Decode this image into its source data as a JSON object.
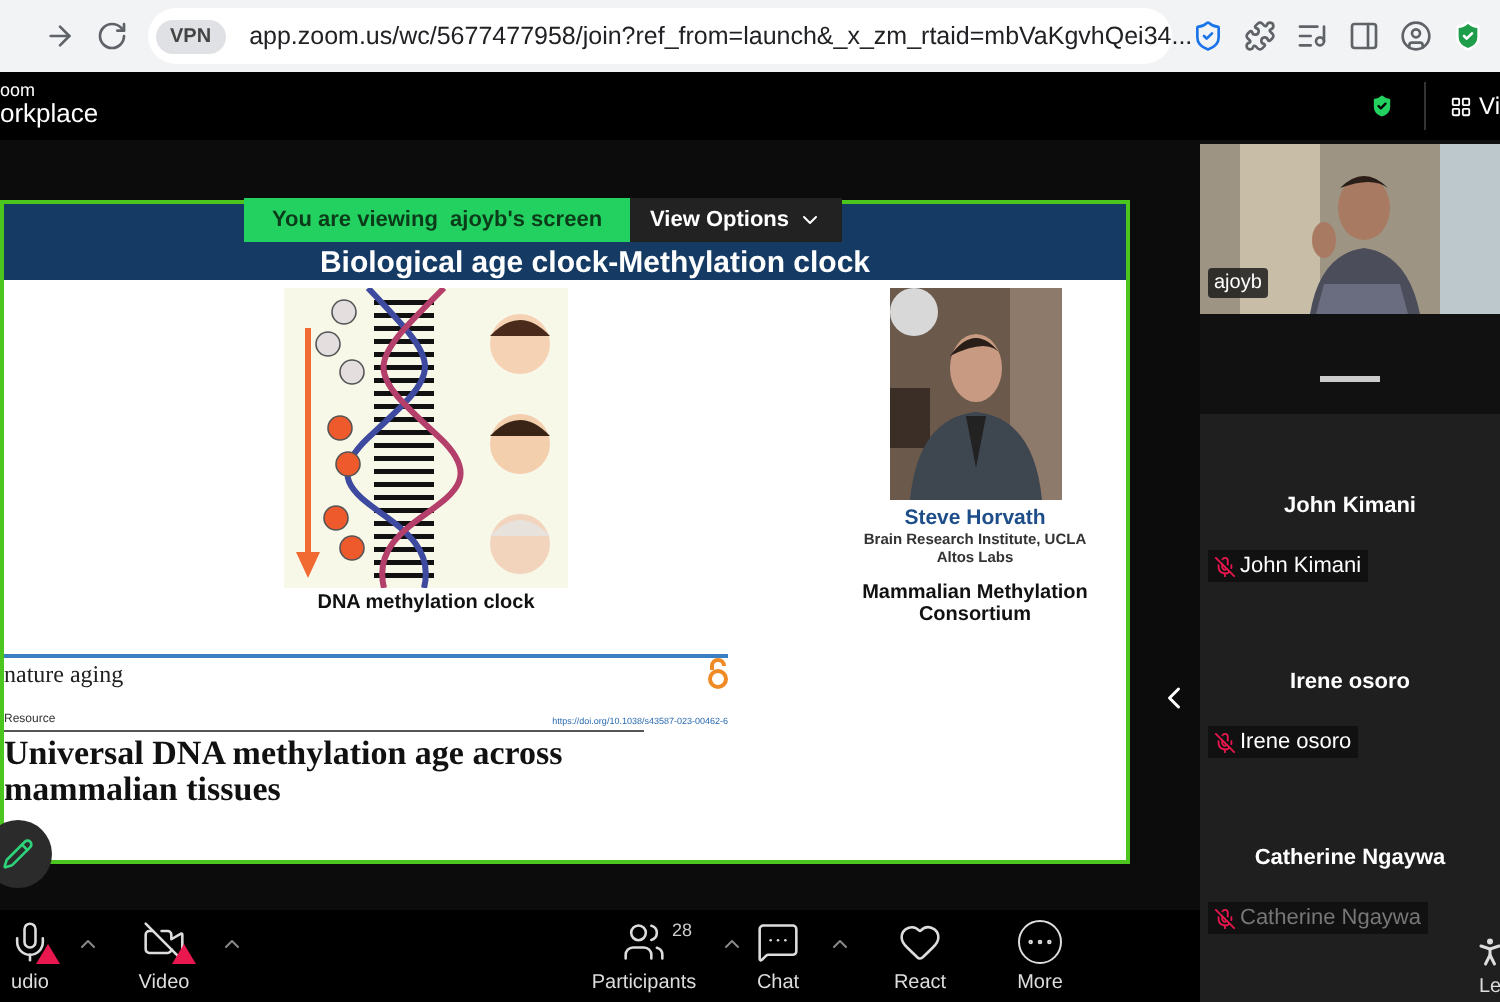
{
  "browser": {
    "vpn_badge": "VPN",
    "url": "app.zoom.us/wc/5677477958/join?ref_from=launch&_x_zm_rtaid=mbVaKgvhQei34..."
  },
  "app_bar": {
    "brand": [
      "oom",
      "orkplace"
    ],
    "view_button": "Vi"
  },
  "share_banner": {
    "viewing": "You are viewing  ajoyb's screen",
    "options": "View Options"
  },
  "slide": {
    "title": "Biological age clock-Methylation clock",
    "figure_caption": "DNA methylation clock",
    "speaker": {
      "name": "Steve Horvath",
      "affiliation": [
        "Brain Research Institute, UCLA",
        "Altos Labs"
      ]
    },
    "consortium": "Mammalian Methylation Consortium",
    "paper": {
      "journal": "nature aging",
      "section": "Resource",
      "doi": "https://doi.org/10.1038/s43587-023-00462-6",
      "title": "Universal DNA methylation age across mammalian tissues"
    }
  },
  "self_video": {
    "name": "ajoyb"
  },
  "participants": [
    {
      "name": "John Kimani",
      "label": "John Kimani",
      "muted": true
    },
    {
      "name": "Irene osoro",
      "label": "Irene osoro",
      "muted": true
    },
    {
      "name": "Catherine Ngaywa",
      "label": "Catherine Ngaywa",
      "muted": true
    }
  ],
  "toolbar": [
    {
      "kind": "audio",
      "label": "udio",
      "warning": true,
      "caret": true
    },
    {
      "kind": "video",
      "label": "Video",
      "warning": true,
      "caret": true
    },
    {
      "kind": "participants",
      "label": "Participants",
      "count": "28",
      "caret": true
    },
    {
      "kind": "chat",
      "label": "Chat",
      "caret": true
    },
    {
      "kind": "react",
      "label": "React"
    },
    {
      "kind": "more",
      "label": "More"
    },
    {
      "kind": "leave",
      "label": "Le"
    }
  ]
}
